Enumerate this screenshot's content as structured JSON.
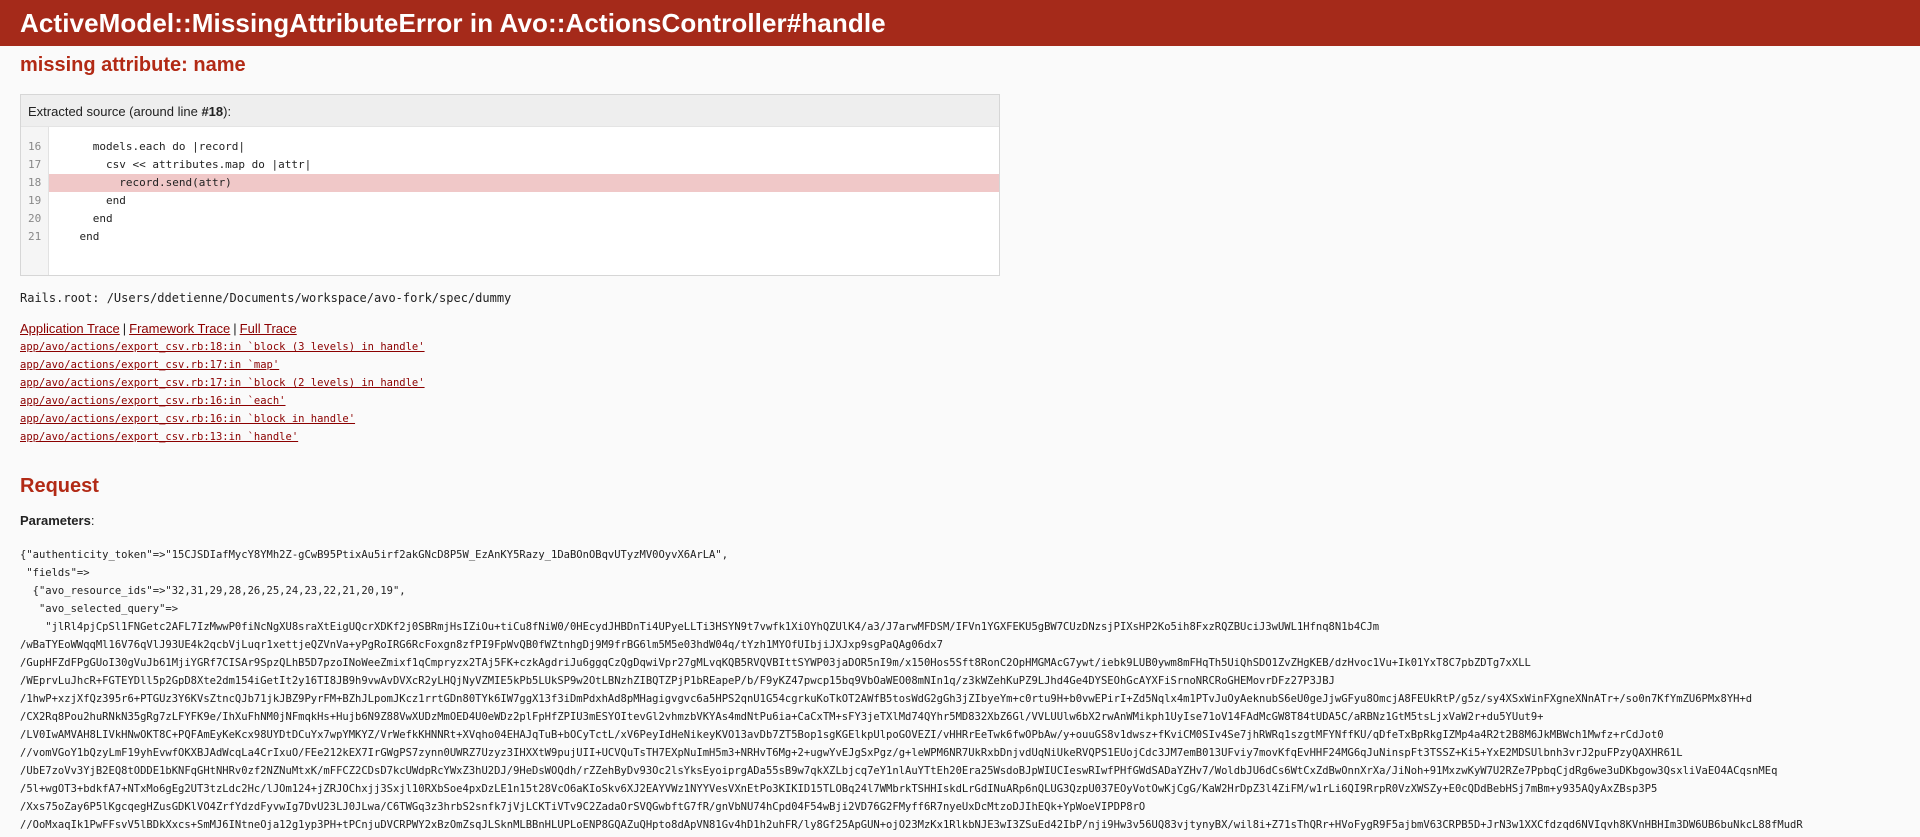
{
  "header": {
    "title": "ActiveModel::MissingAttributeError in Avo::ActionsController#handle"
  },
  "exception": {
    "message": "missing attribute: name"
  },
  "source": {
    "caption_prefix": "Extracted source (around line ",
    "caption_line": "#18",
    "caption_suffix": "):",
    "line_numbers": [
      "16",
      "17",
      "18",
      "19",
      "20",
      "21"
    ],
    "lines": [
      "      models.each do |record|",
      "        csv << attributes.map do |attr|",
      "          record.send(attr)",
      "        end",
      "      end",
      "    end"
    ],
    "highlight_index": 2
  },
  "rails_root": "Rails.root: /Users/ddetienne/Documents/workspace/avo-fork/spec/dummy",
  "trace_links": {
    "application": "Application Trace",
    "framework": "Framework Trace",
    "full": "Full Trace",
    "separator": "|"
  },
  "trace": [
    "app/avo/actions/export_csv.rb:18:in `block (3 levels) in handle'",
    "app/avo/actions/export_csv.rb:17:in `map'",
    "app/avo/actions/export_csv.rb:17:in `block (2 levels) in handle'",
    "app/avo/actions/export_csv.rb:16:in `each'",
    "app/avo/actions/export_csv.rb:16:in `block in handle'",
    "app/avo/actions/export_csv.rb:13:in `handle'"
  ],
  "request": {
    "heading": "Request",
    "params_label": "Parameters",
    "params_colon": ":",
    "params_lines": [
      "{\"authenticity_token\"=>\"15CJSDIafMycY8YMh2Z-gCwB95PtixAu5irf2akGNcD8P5W_EzAnKY5Razy_1DaBOnOBqvUTyzMV0OyvX6ArLA\",",
      " \"fields\"=>",
      "  {\"avo_resource_ids\"=>\"32,31,29,28,26,25,24,23,22,21,20,19\",",
      "   \"avo_selected_query\"=>",
      "    \"jlRl4pjCpSl1FNGetc2AFL7IzMwwP0fiNcNgXU8sraXtEigUQcrXDKf2j0SBRmjHsIZiOu+tiCu8fNiW0/0HEcydJHBDnTi4UPyeLLTi3HSYN9t7vwfk1XiOYhQZUlK4/a3/J7arwMFDSM/IFVn1YGXFEKU5gBW7CUzDNzsjPIXsHP2Ko5ih8FxzRQZBUciJ3wUWL1Hfnq8N1b4CJm",
      "/wBaTYEoWWqqMl16V76qVlJ93UE4k2qcbVjLuqr1xettjeQZVnVa+yPgRoIRG6RcFoxgn8zfPI9FpWvQB0fWZtnhgDj9M9frBG6lm5M5e03hdW04q/tYzh1MYOfUIbjiJXJxp9sgPaQAg06dx7",
      "/GupHFZdFPgGUoI30gVuJb61MjiYGRf7CISAr9SpzQLhB5D7pzoINoWeeZmixf1qCmpryzx2TAj5FK+czkAgdriJu6ggqCzQgDqwiVpr27gMLvqKQB5RVQVBIttSYWP03jaDOR5nI9m/x150Hos5Sft8RonC2OpHMGMAcG7ywt/iebk9LUB0ywm8mFHqTh5UiQhSDO1ZvZHgKEB/dzHvoc1Vu+Ik01YxT8C7pbZDTg7xXLL",
      "/WEprvLuJhcR+FGTEYDll5p2GpD8Xte2dm154iGetIt2y16TI8JB9h9vwAvDVXcR2yLHQjNyVZMIE5kPb5LUkSP9w2OtLBNzhZIBQTZPjP1bREapeP/b/F9yKZ47pwcp15bq9VbOaWEO08mNIn1q/z3kWZehKuPZ9LJhd4Ge4DYSEOhGcAYXFiSrnoNRCRoGHEMovrDFz27P3JBJ",
      "/1hwP+xzjXfQz395r6+PTGUz3Y6KVsZtncQJb71jkJBZ9PyrFM+BZhJLpomJKcz1rrtGDn80TYk6IW7ggX13f3iDmPdxhAd8pMHagigvgvc6a5HPS2qnU1G54cgrkuKoTkOT2AWfB5tosWdG2gGh3jZIbyeYm+c0rtu9H+b0vwEPirI+Zd5Nqlx4m1PTvJuOyAeknubS6eU0geJjwGFyu8OmcjA8FEUkRtP/g5z/sy4XSxWinFXgneXNnATr+/so0n7KfYmZU6PMx8YH+d",
      "/CX2Rq8Pou2huRNkN35gRg7zLFYFK9e/IhXuFhNM0jNFmqkHs+Hujb6N9Z88VwXUDzMmOED4U0eWDz2plFpHfZPIU3mESYOItevGl2vhmzbVKYAs4mdNtPu6ia+CaCxTM+sFY3jeTXlMd74QYhr5MD832XbZ6Gl/VVLUUlw6bX2rwAnWMikph1UyIse71oV14FAdMcGW8T84tUDA5C/aRBNz1GtM5tsLjxVaW2r+du5YUut9+",
      "/LV0IwAMVAH8LIVkHNwOKT8C+PQFAmEyKeKcx98UYDtDCuYx7wpYMKYZ/VrWefkKHNNRt+XVqho04EHAJqTuB+bOCyTctL/xV6PeyIdHeNikeyKVO13avDb7ZT5Bop1sgKGElkpUlpoGOVEZI/vHHRrEeTwk6fwOPbAw/y+ouuGS8v1dwsz+fKviCM0SIv4Se7jhRWRq1szgtMFYNffKU/qDfeTxBpRkgIZMp4a4R2t2B8M6JkMBWch1Mwfz+rCdJot0",
      "//vomVGoY1bQzyLmF19yhEvwfOKXBJAdWcqLa4CrIxuO/FEe212kEX7IrGWgPS7zynn0UWRZ7Uzyz3IHXXtW9pujUII+UCVQuTsTH7EXpNuImH5m3+NRHvT6Mg+2+ugwYvEJgSxPgz/g+leWPM6NR7UkRxbDnjvdUqNiUkeRVQPS1EUojCdc3JM7emB013UFviy7movKfqEvHHF24MG6qJuNinspFt3TSSZ+Ki5+YxE2MDSUlbnh3vrJ2puFPzyQAXHR61L",
      "/UbE7zoVv3YjB2EQ8tODDE1bKNFqGHtNHRv0zf2NZNuMtxK/mFFCZ2CDsD7kcUWdpRcYWxZ3hU2DJ/9HeDsWOQdh/rZZehByDv93Oc2lsYksEyoiprgADa55sB9w7qkXZLbjcq7eY1nlAuYTtEh20Era25WsdoBJpWIUCIeswRIwfPHfGWdSADaYZHv7/WoldbJU6dCs6WtCxZdBwOnnXrXa/JiNoh+91MxzwKyW7U2RZe7PpbqCjdRg6we3uDKbgow3QsxliVaEO4ACqsnMEq",
      "/5l+wgOT3+bdkfA7+NTxMo6gEg2UT3tzLdc2Hc/lJOm124+jZRJOChxjj3Sxjl10RXbSoe4pxDzLE1n15t28VcO6aKIoSkv6XJ2EAYVWz1NYYVesVXnEtPo3KIKID15TLOBq24l7WMbrkTSHHIskdLrGdINuARp6nQLUG3QzpU037EOyVotOwKjCgG/KaW2HrDpZ3l4ZiFM/w1rLi6QI9RrpR0VzXWSZy+E0cQDdBebHSj7mBm+y935AQyAxZBsp3P5",
      "/Xxs75oZay6P5lKgcqegHZusGDKlVO4ZrfYdzdFyvwIg7DvU23LJ0JLwa/C6TWGq3z3hrbS2snfk7jVjLCKTiVTv9C2ZadaOrSVQGwbftG7fR/gnVbNU74hCpd04F54wBji2VD76G2FMyff6R7nyeUxDcMtzoDJIhEQk+YpWoeVIPDP8rO",
      "//OoMxaqIk1PwFFsvV5lBDkXxcs+SmMJ6INtneOja12g1yp3PH+tPCnjuDVCRPWY2xBzOmZsqJLSknMLBBnHLUPLoENP8GQAZuQHpto8dApVN81Gv4hD1h2uhFR/ly8Gf25ApGUN+ojO23MzKx1RlkbNJE3wI3ZSuEd42IbP/nji9Hw3v56UQ83vjtynyBX/wil8i+Z71sThQRr+HVoFygR9F5ajbmV63CRPB5D+JrN3w1XXCfdzqd6NVIqvh8KVnHBHIm3DW6UB6buNkcL88fMudR"
    ]
  }
}
